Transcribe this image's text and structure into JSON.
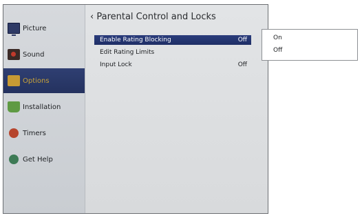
{
  "sidebar": {
    "items": [
      {
        "label": "Picture",
        "icon": "tv-icon"
      },
      {
        "label": "Sound",
        "icon": "speaker-icon"
      },
      {
        "label": "Options",
        "icon": "options-icon"
      },
      {
        "label": "Installation",
        "icon": "antenna-icon"
      },
      {
        "label": "Timers",
        "icon": "alarm-clock-icon"
      },
      {
        "label": "Get Help",
        "icon": "help-icon"
      }
    ],
    "active_index": 2
  },
  "panel": {
    "title": "Parental Control and Locks",
    "back_glyph": "‹",
    "rows": [
      {
        "label": "Enable Rating Blocking",
        "value": "Off"
      },
      {
        "label": "Edit Rating Limits",
        "value": ""
      },
      {
        "label": "Input Lock",
        "value": "Off"
      }
    ]
  },
  "popup": {
    "options": [
      "On",
      "Off"
    ]
  },
  "colors": {
    "selection_blue": "#24325f",
    "active_text_gold": "#c9a238"
  }
}
